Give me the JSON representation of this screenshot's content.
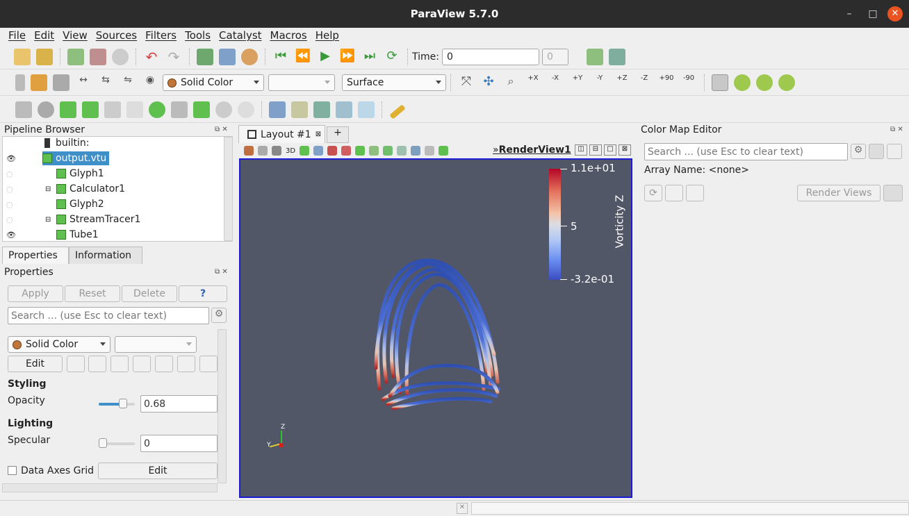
{
  "window": {
    "title": "ParaView 5.7.0",
    "min": "–",
    "max": "□",
    "close": "✕"
  },
  "menu": [
    "File",
    "Edit",
    "View",
    "Sources",
    "Filters",
    "Tools",
    "Catalyst",
    "Macros",
    "Help"
  ],
  "toolbar": {
    "time_label": "Time:",
    "time_value": "0",
    "timestep_value": "0",
    "coloring": "Solid Color",
    "component": "",
    "representation": "Surface",
    "view_labels": [
      "+X",
      "-X",
      "+Y",
      "-Y",
      "+Z",
      "-Z",
      "+90",
      "-90"
    ]
  },
  "pipeline": {
    "title": "Pipeline Browser",
    "items": [
      {
        "label": "builtin:",
        "visible": null
      },
      {
        "label": "output.vtu",
        "visible": true
      },
      {
        "label": "Glyph1",
        "visible": false
      },
      {
        "label": "Calculator1",
        "visible": false
      },
      {
        "label": "Glyph2",
        "visible": false
      },
      {
        "label": "StreamTracer1",
        "visible": false
      },
      {
        "label": "Tube1",
        "visible": true
      }
    ]
  },
  "tabs": {
    "properties": "Properties",
    "information": "Information"
  },
  "properties": {
    "title": "Properties",
    "apply": "Apply",
    "reset": "Reset",
    "delete": "Delete",
    "help": "?",
    "search_placeholder": "Search ... (use Esc to clear text)",
    "coloring": "Solid Color",
    "edit": "Edit",
    "styling": "Styling",
    "opacity_label": "Opacity",
    "opacity_value": "0.68",
    "opacity_fraction": 0.68,
    "lighting": "Lighting",
    "specular_label": "Specular",
    "specular_value": "0",
    "data_axes_grid": "Data Axes Grid",
    "grid_edit": "Edit"
  },
  "layout": {
    "tab": "Layout #1",
    "add": "+",
    "view_name": "RenderView1",
    "label_3d": "3D"
  },
  "colorbar": {
    "title": "Vorticity Z",
    "max": "1.1e+01",
    "mid": "5",
    "min": "-3.2e-01"
  },
  "axes": {
    "z": "Z",
    "y": "Y"
  },
  "colormap": {
    "title": "Color Map Editor",
    "search_placeholder": "Search ... (use Esc to clear text)",
    "array_name": "Array Name: <none>",
    "render_views": "Render Views"
  }
}
